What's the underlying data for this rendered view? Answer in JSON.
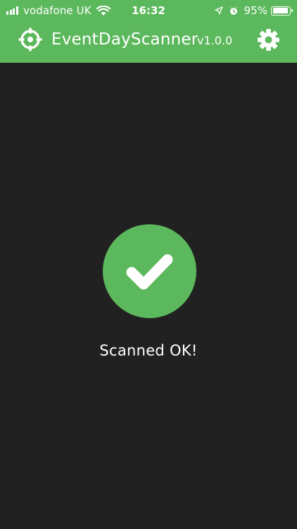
{
  "status_bar": {
    "carrier": "vodafone UK",
    "time": "16:32",
    "battery_percent": "95%",
    "battery_level": 0.95,
    "icons": [
      "signal-bars-icon",
      "wifi-icon",
      "location-arrow-icon",
      "alarm-clock-icon",
      "battery-icon"
    ]
  },
  "app_bar": {
    "title": "EventDayScanner",
    "version": "v1.0.0",
    "left_icon": "crosshair-icon",
    "right_icon": "gear-icon",
    "background_color": "#5cb85c"
  },
  "main": {
    "status_icon": "checkmark-icon",
    "message": "Scanned OK!",
    "success_color": "#5cb85c",
    "background_color": "#212121"
  }
}
